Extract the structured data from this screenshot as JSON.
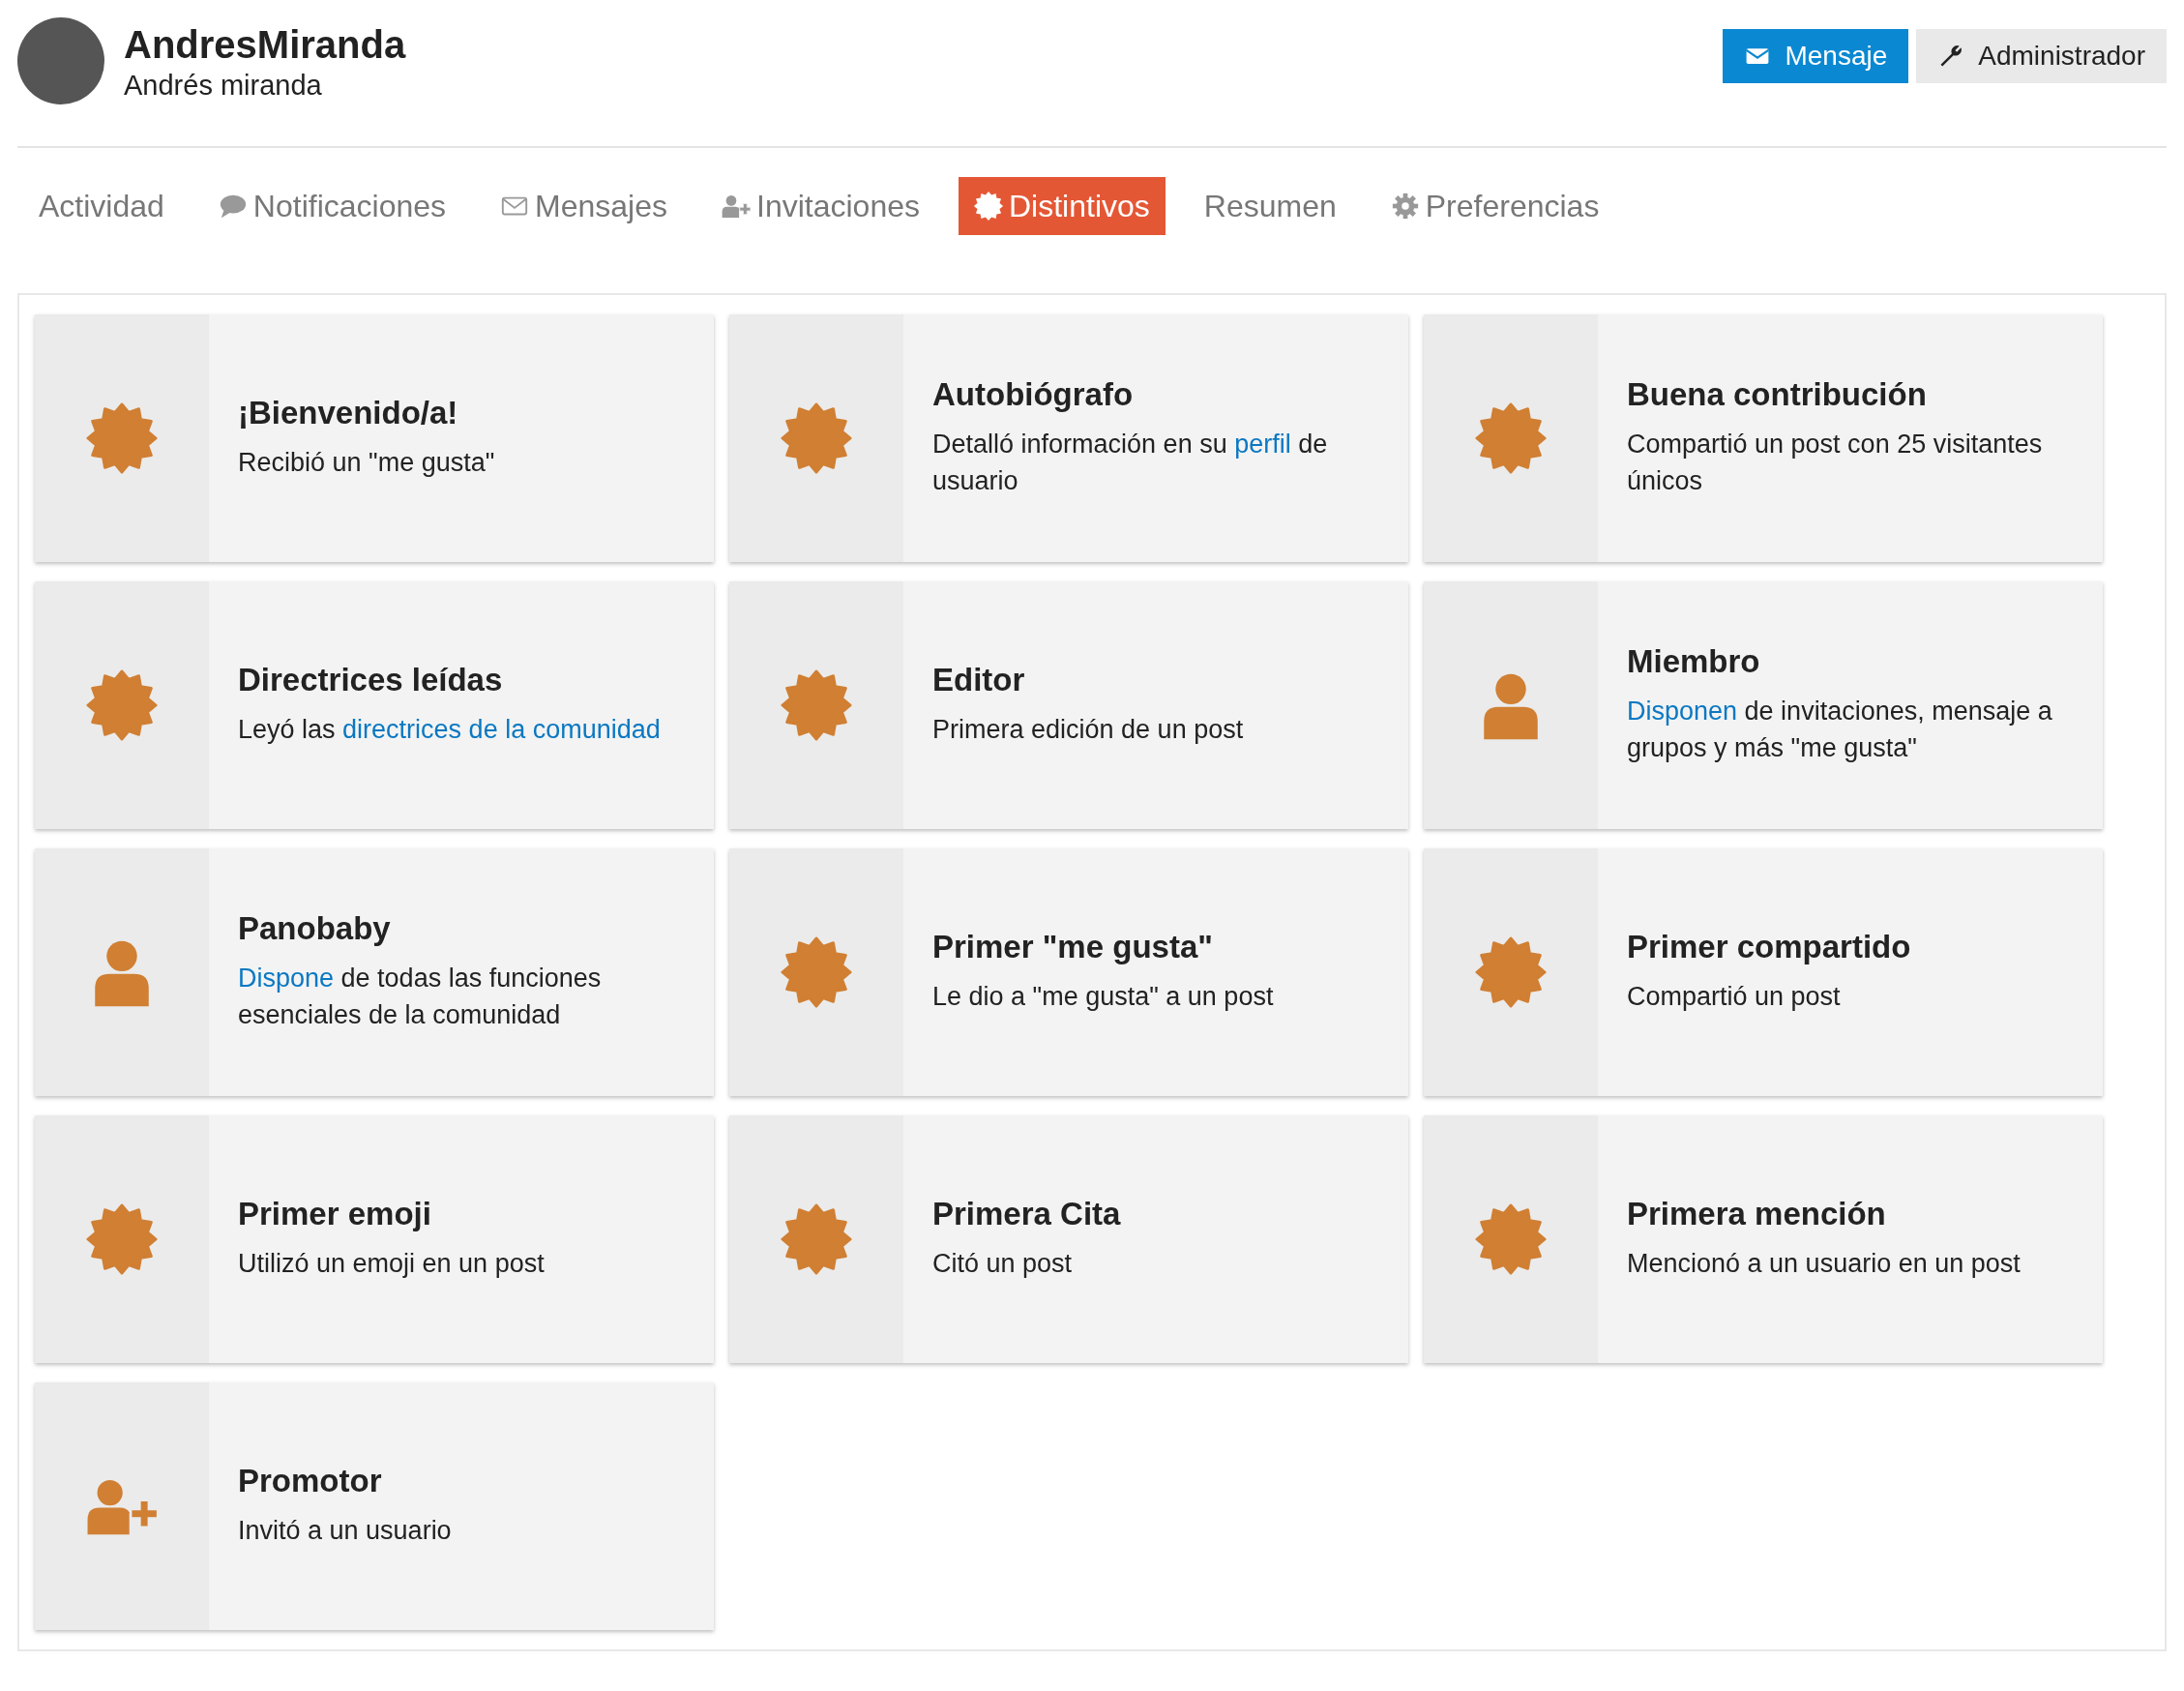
{
  "user": {
    "username": "AndresMiranda",
    "full_name": "Andrés miranda"
  },
  "actions": [
    {
      "label": "Mensaje",
      "kind": "primary"
    },
    {
      "label": "Administrador",
      "kind": "default"
    }
  ],
  "tabs": [
    {
      "label": "Actividad",
      "kind": "none",
      "selected": false
    },
    {
      "label": "Notificaciones",
      "kind": "comment",
      "selected": false
    },
    {
      "label": "Mensajes",
      "kind": "envelope",
      "selected": false
    },
    {
      "label": "Invitaciones",
      "kind": "user-plus",
      "selected": false
    },
    {
      "label": "Distintivos",
      "kind": "badge",
      "selected": true
    },
    {
      "label": "Resumen",
      "kind": "none",
      "selected": false
    },
    {
      "label": "Preferencias",
      "kind": "gear",
      "selected": false
    }
  ],
  "badges": [
    {
      "title": "¡Bienvenido/a!",
      "kind": "badge",
      "description": [
        {
          "text": "Recibió un \"me gusta\"",
          "kind": "text"
        }
      ]
    },
    {
      "title": "Autobiógrafo",
      "kind": "badge",
      "description": [
        {
          "text": "Detalló información en su ",
          "kind": "text"
        },
        {
          "text": "perfil",
          "kind": "link"
        },
        {
          "text": " de usuario",
          "kind": "text"
        }
      ]
    },
    {
      "title": "Buena contribución",
      "kind": "badge",
      "description": [
        {
          "text": "Compartió un post con 25 visitantes únicos",
          "kind": "text"
        }
      ]
    },
    {
      "title": "Directrices leídas",
      "kind": "badge",
      "description": [
        {
          "text": "Leyó las ",
          "kind": "text"
        },
        {
          "text": "directrices de la comunidad",
          "kind": "link"
        }
      ]
    },
    {
      "title": "Editor",
      "kind": "badge",
      "description": [
        {
          "text": "Primera edición de un post",
          "kind": "text"
        }
      ]
    },
    {
      "title": "Miembro",
      "kind": "user",
      "description": [
        {
          "text": "Disponen",
          "kind": "link"
        },
        {
          "text": " de invitaciones, mensaje a grupos y más \"me gusta\"",
          "kind": "text"
        }
      ]
    },
    {
      "title": "Panobaby",
      "kind": "user",
      "description": [
        {
          "text": "Dispone",
          "kind": "link"
        },
        {
          "text": " de todas las funciones esenciales de la comunidad",
          "kind": "text"
        }
      ]
    },
    {
      "title": "Primer \"me gusta\"",
      "kind": "badge",
      "description": [
        {
          "text": "Le dio a \"me gusta\" a un post",
          "kind": "text"
        }
      ]
    },
    {
      "title": "Primer compartido",
      "kind": "badge",
      "description": [
        {
          "text": "Compartió un post",
          "kind": "text"
        }
      ]
    },
    {
      "title": "Primer emoji",
      "kind": "badge",
      "description": [
        {
          "text": "Utilizó un emoji en un post",
          "kind": "text"
        }
      ]
    },
    {
      "title": "Primera Cita",
      "kind": "badge",
      "description": [
        {
          "text": "Citó un post",
          "kind": "text"
        }
      ]
    },
    {
      "title": "Primera mención",
      "kind": "badge",
      "description": [
        {
          "text": "Mencionó a un usuario en un post",
          "kind": "text"
        }
      ]
    },
    {
      "title": "Promotor",
      "kind": "user-plus",
      "description": [
        {
          "text": "Invitó a un usuario",
          "kind": "text"
        }
      ]
    }
  ]
}
